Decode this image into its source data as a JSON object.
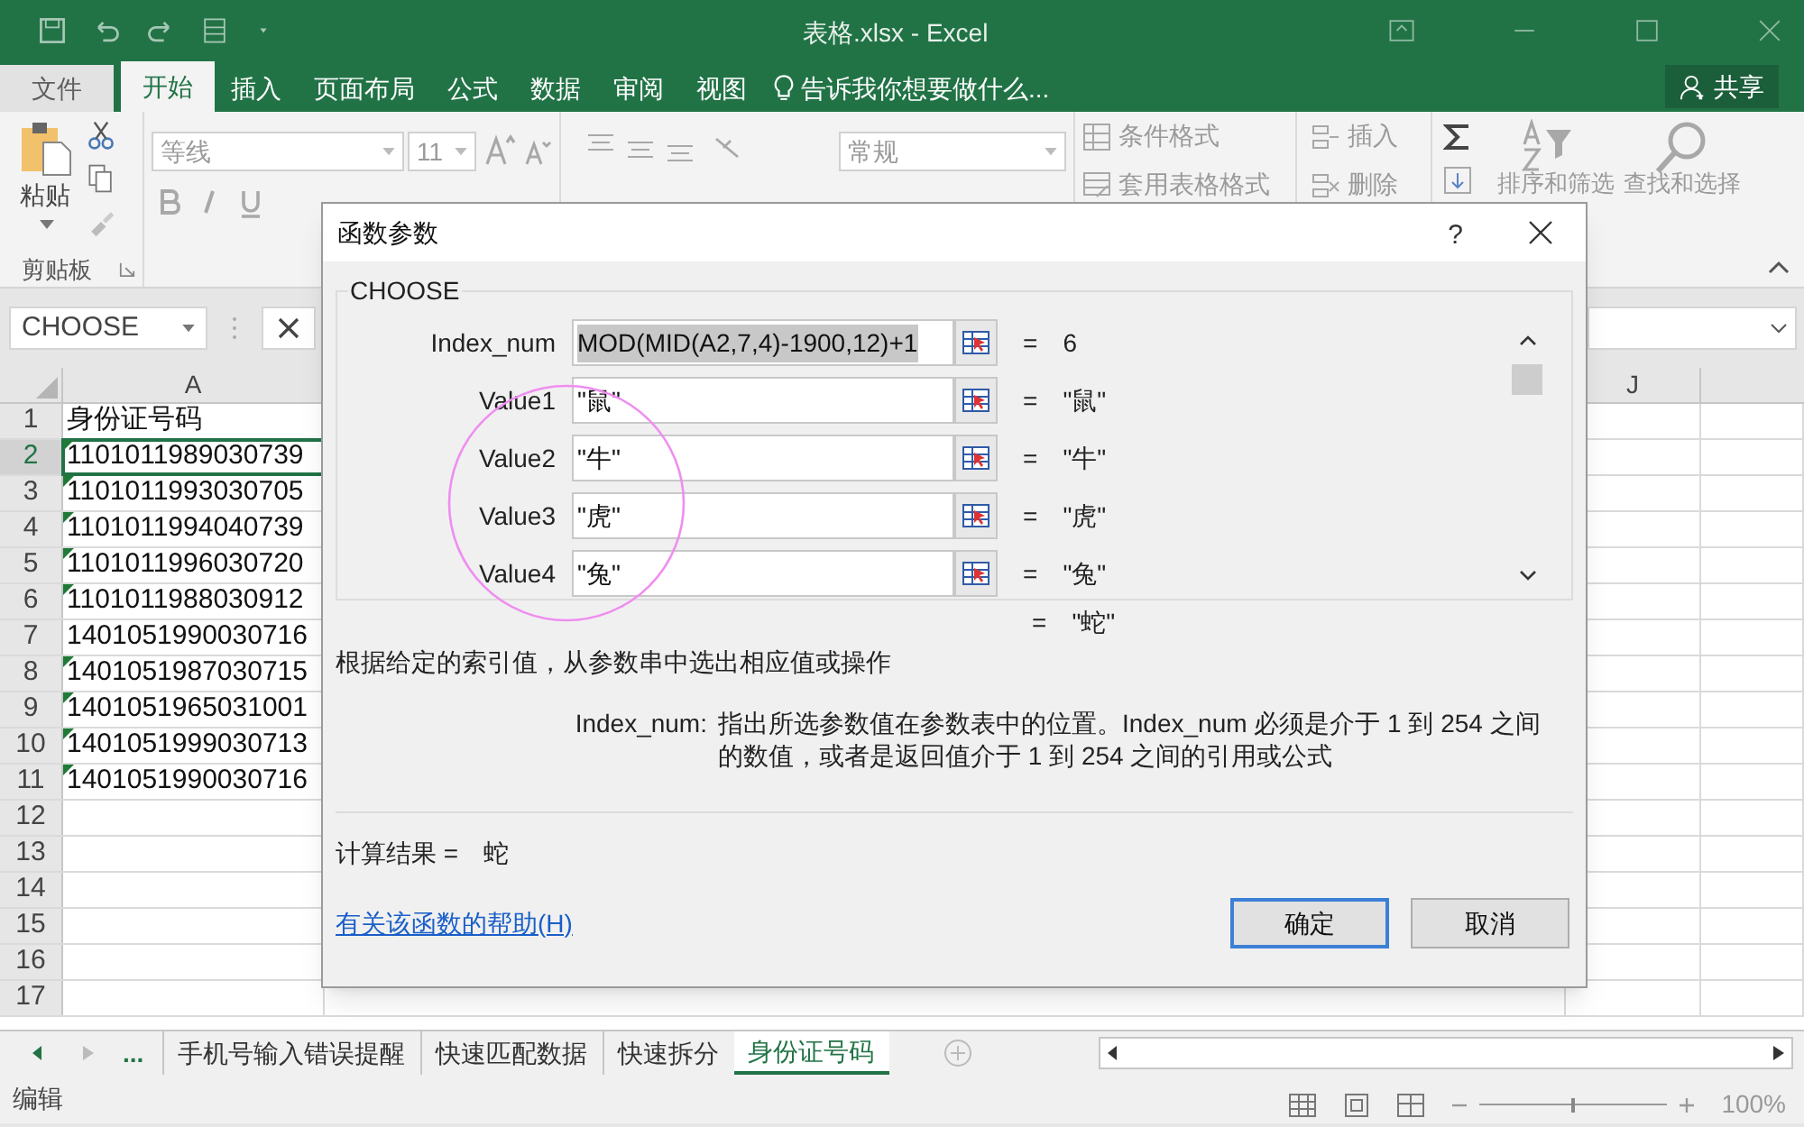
{
  "window": {
    "title": "表格.xlsx - Excel"
  },
  "share_button": "共享",
  "ribbon_tabs": [
    {
      "label": "文件",
      "kind": "file",
      "selected": false
    },
    {
      "label": "开始",
      "kind": "tab",
      "selected": true
    },
    {
      "label": "插入",
      "kind": "tab",
      "selected": false
    },
    {
      "label": "页面布局",
      "kind": "tab",
      "selected": false
    },
    {
      "label": "公式",
      "kind": "tab",
      "selected": false
    },
    {
      "label": "数据",
      "kind": "tab",
      "selected": false
    },
    {
      "label": "审阅",
      "kind": "tab",
      "selected": false
    },
    {
      "label": "视图",
      "kind": "tab",
      "selected": false
    }
  ],
  "tell_me": "告诉我你想要做什么...",
  "ribbon": {
    "paste": "粘贴",
    "clipboard_group": "剪贴板",
    "font": "等线",
    "font_size": "11",
    "number_format": "常规",
    "conditional_format": "条件格式",
    "table_format": "套用表格格式",
    "insert": "插入",
    "delete": "删除",
    "sort_filter": "排序和筛选",
    "find_select": "查找和选择"
  },
  "name_box": "CHOOSE",
  "sheet": {
    "columns": [
      {
        "label": "A"
      },
      {
        "label": "J"
      }
    ],
    "rows": [
      {
        "number": "1",
        "value": "身份证号码",
        "error_flag": false,
        "selected": false
      },
      {
        "number": "2",
        "value": "1101011989030739",
        "error_flag": true,
        "selected": true
      },
      {
        "number": "3",
        "value": "1101011993030705",
        "error_flag": true,
        "selected": false
      },
      {
        "number": "4",
        "value": "1101011994040739",
        "error_flag": true,
        "selected": false
      },
      {
        "number": "5",
        "value": "1101011996030720",
        "error_flag": true,
        "selected": false
      },
      {
        "number": "6",
        "value": "1101011988030912",
        "error_flag": true,
        "selected": false
      },
      {
        "number": "7",
        "value": "1401051990030716",
        "error_flag": false,
        "selected": false
      },
      {
        "number": "8",
        "value": "1401051987030715",
        "error_flag": true,
        "selected": false
      },
      {
        "number": "9",
        "value": "1401051965031001",
        "error_flag": true,
        "selected": false
      },
      {
        "number": "10",
        "value": "1401051999030713",
        "error_flag": true,
        "selected": false
      },
      {
        "number": "11",
        "value": "1401051990030716",
        "error_flag": true,
        "selected": false
      },
      {
        "number": "12",
        "error_flag": false,
        "selected": false
      },
      {
        "number": "13",
        "error_flag": false,
        "selected": false
      },
      {
        "number": "14",
        "error_flag": false,
        "selected": false
      },
      {
        "number": "15",
        "error_flag": false,
        "selected": false
      },
      {
        "number": "16",
        "error_flag": false,
        "selected": false
      },
      {
        "number": "17",
        "error_flag": false,
        "selected": false
      }
    ]
  },
  "dialog": {
    "title": "函数参数",
    "help": "?",
    "function_name": "CHOOSE",
    "arguments": [
      {
        "label": "Index_num",
        "value": "MOD(MID(A2,7,4)-1900,12)+1",
        "equals": "=",
        "result": "6"
      },
      {
        "label": "Value1",
        "value": "\"鼠\"",
        "equals": "=",
        "result": "\"鼠\""
      },
      {
        "label": "Value2",
        "value": "\"牛\"",
        "equals": "=",
        "result": "\"牛\""
      },
      {
        "label": "Value3",
        "value": "\"虎\"",
        "equals": "=",
        "result": "\"虎\""
      },
      {
        "label": "Value4",
        "value": "\"兔\"",
        "equals": "=",
        "result": "\"兔\""
      }
    ],
    "overall_equals": "=",
    "overall_result": "\"蛇\"",
    "description": "根据给定的索引值，从参数串中选出相应值或操作",
    "argument_name": "Index_num:",
    "argument_help": "指出所选参数值在参数表中的位置。Index_num 必须是介于 1 到 254 之间的数值，或者是返回值介于 1 到 254 之间的引用或公式",
    "result_label": "计算结果 =",
    "result_value": "蛇",
    "help_link": "有关该函数的帮助(H)",
    "buttons": [
      {
        "label": "确定",
        "default": true
      },
      {
        "label": "取消",
        "default": false
      }
    ]
  },
  "sheet_tabs": {
    "more": "...",
    "tabs": [
      {
        "label": "手机号输入错误提醒",
        "selected": false
      },
      {
        "label": "快速匹配数据",
        "selected": false
      },
      {
        "label": "快速拆分",
        "selected": false
      },
      {
        "label": "身份证号码",
        "selected": true
      }
    ]
  },
  "status_bar": {
    "mode": "编辑",
    "zoom": "100%",
    "level": 0.5
  }
}
